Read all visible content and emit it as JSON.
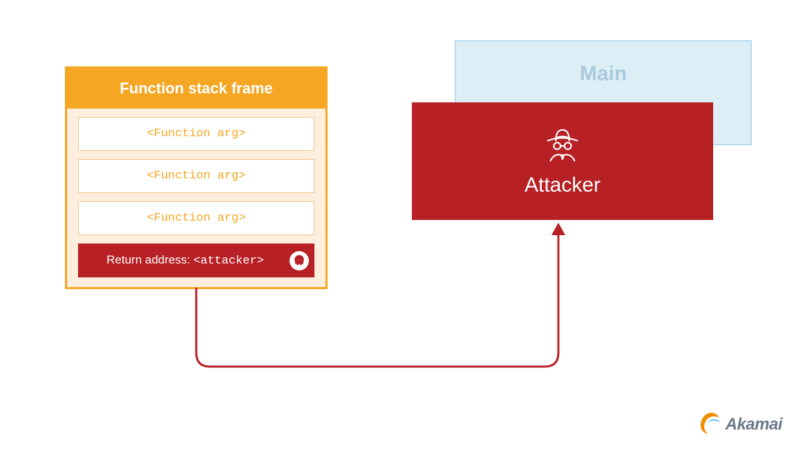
{
  "stack": {
    "title": "Function stack frame",
    "args": [
      "<Function arg>",
      "<Function arg>",
      "<Function arg>"
    ],
    "return_label": "Return address: ",
    "return_value": "<attacker>"
  },
  "main": {
    "title": "Main"
  },
  "attacker": {
    "label": "Attacker"
  },
  "brand": {
    "name": "Akamai"
  },
  "colors": {
    "orange": "#f5a623",
    "orange_fill": "#fdeedd",
    "red": "#b72025",
    "main_bg": "#dceef6",
    "main_border": "#b7dcef",
    "main_text": "#a9cadd",
    "logo_orange": "#f08c00",
    "logo_grey": "#6a7a8a"
  }
}
